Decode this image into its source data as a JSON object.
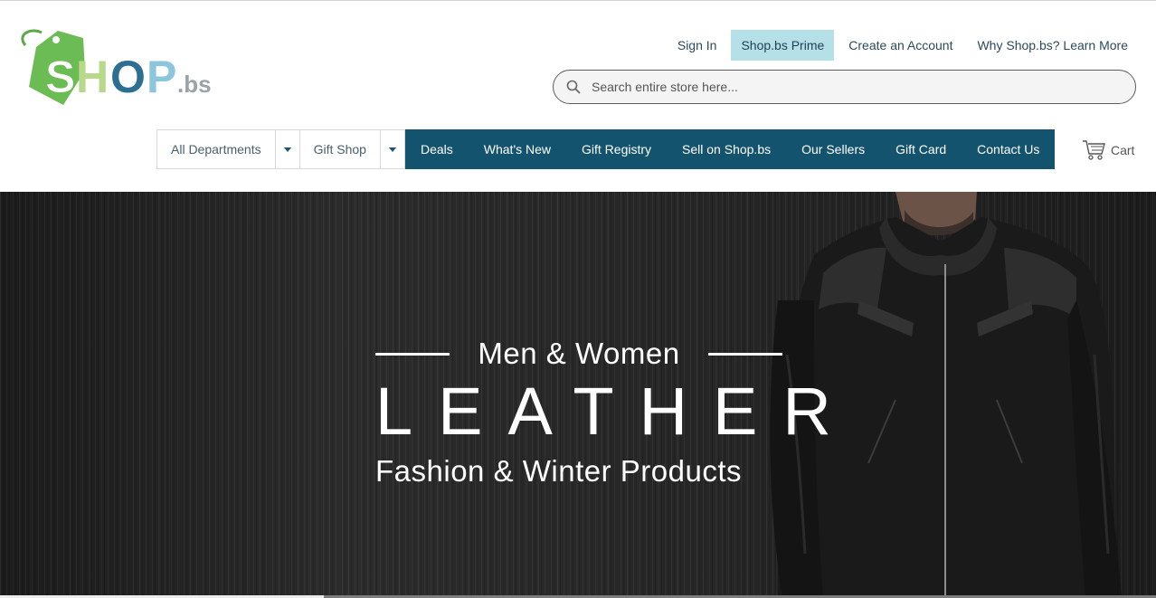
{
  "logo": {
    "text_main": "SHOP",
    "text_suffix": ".bs",
    "icon": "price-tag-icon"
  },
  "header": {
    "links": [
      {
        "label": "Sign In"
      },
      {
        "label": "Shop.bs Prime"
      },
      {
        "label": "Create an Account"
      },
      {
        "label": "Why Shop.bs? Learn More"
      }
    ]
  },
  "search": {
    "placeholder": "Search entire store here...",
    "value": "",
    "icon": "search-icon"
  },
  "nav": {
    "departments_label": "All Departments",
    "giftshop_label": "Gift Shop",
    "items": [
      {
        "label": "Deals"
      },
      {
        "label": "What's New"
      },
      {
        "label": "Gift Registry"
      },
      {
        "label": "Sell on Shop.bs"
      },
      {
        "label": "Our Sellers"
      },
      {
        "label": "Gift Card"
      },
      {
        "label": "Contact Us"
      }
    ],
    "cart_label": "Cart",
    "cart_icon": "cart-icon"
  },
  "hero": {
    "line1": "Men & Women",
    "line2": "LEATHER",
    "line3": "Fashion & Winter Products"
  },
  "slider": {
    "progress": 0.28
  },
  "colors": {
    "nav_bar": "#14536e",
    "prime_bg": "#b6e0e8",
    "logo_green": "#6fbf5a",
    "logo_blue": "#2c6f93"
  }
}
